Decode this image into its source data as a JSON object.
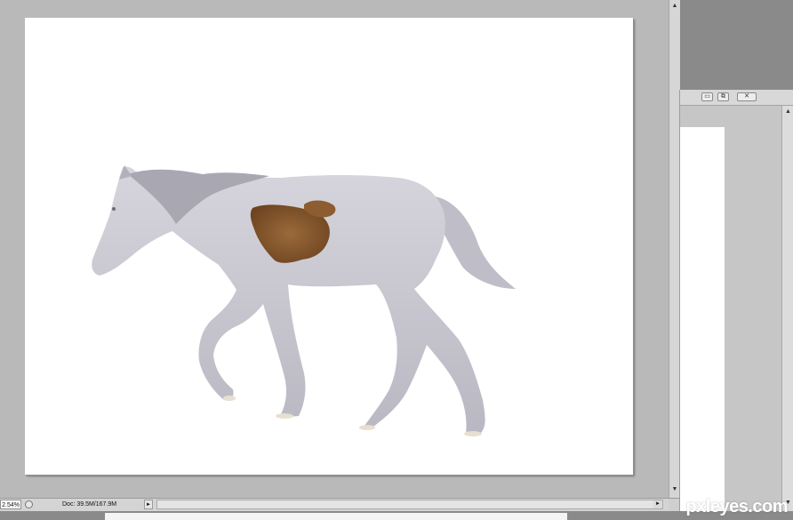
{
  "status_bar": {
    "zoom": "2.54%",
    "doc_info": "Doc: 39.5M/167.9M"
  },
  "icons": {
    "info": "info-icon",
    "flyout_arrow": "triangle-right-icon",
    "scroll_up": "triangle-up-icon",
    "scroll_down": "triangle-down-icon",
    "scroll_right": "triangle-right-icon",
    "minimize": "minimize-icon",
    "restore": "restore-icon",
    "close": "close-icon"
  },
  "window2": {
    "minimize_label": "▭",
    "restore_label": "⧉",
    "close_label": "✕"
  },
  "scroll": {
    "up": "▲",
    "down": "▼",
    "right": "►",
    "flyout": "►"
  },
  "watermark": "pxleyes.com",
  "colors": {
    "workspace": "#b9b9b9",
    "canvas": "#ffffff",
    "horse": "#c9c8d1",
    "patch": "#8a5a2e"
  }
}
